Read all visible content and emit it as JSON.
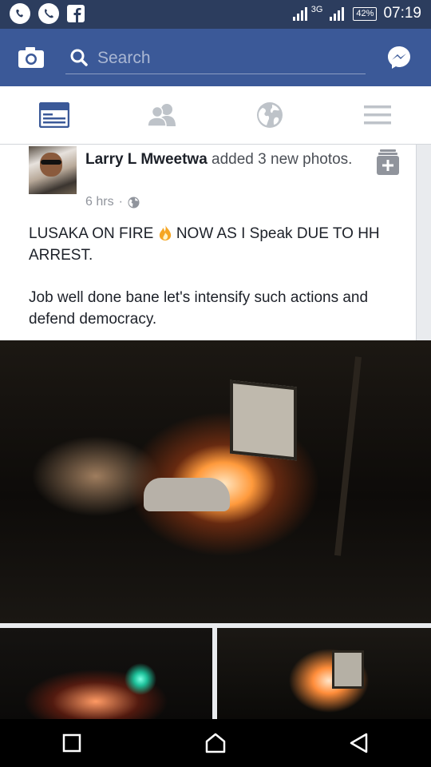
{
  "status_bar": {
    "network_label": "3G",
    "battery": "42%",
    "time": "07:19"
  },
  "header": {
    "search_placeholder": "Search"
  },
  "post": {
    "author": "Larry L Mweetwa",
    "action": " added 3 new photos.",
    "time": "6 hrs",
    "separator": "·",
    "text_line1_a": "LUSAKA ON FIRE ",
    "text_line1_b": " NOW AS I Speak DUE TO HH ARREST.",
    "text_para2": "Job well done bane let's intensify such actions and defend democracy."
  },
  "colors": {
    "header_bg": "#3b5998",
    "status_bg": "#2c3d5e",
    "active_tab": "#3b5998",
    "inactive_tab": "#bec3c9"
  }
}
